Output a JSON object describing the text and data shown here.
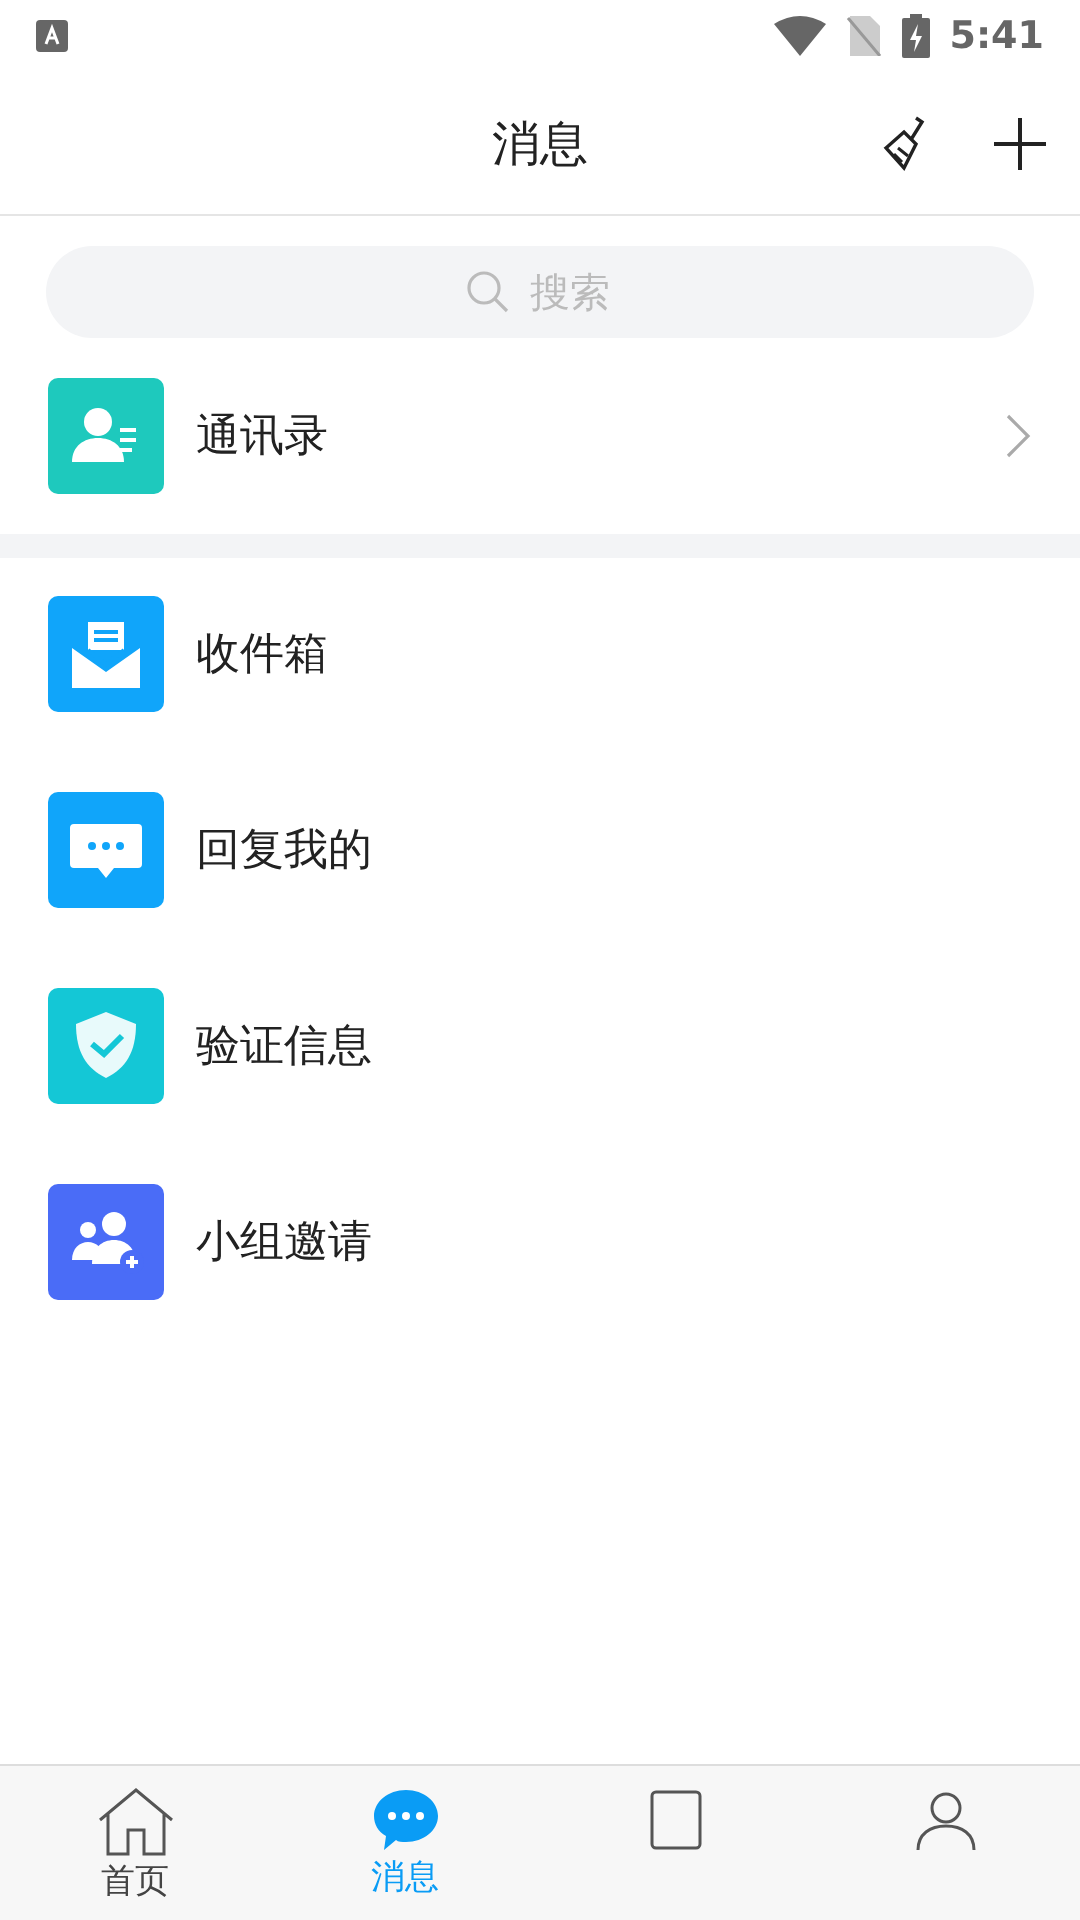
{
  "status_bar": {
    "time": "5:41"
  },
  "header": {
    "title": "消息"
  },
  "search": {
    "placeholder": "搜索"
  },
  "contacts": {
    "label": "通讯录",
    "kind": "contacts",
    "color": "#1ec9bd"
  },
  "items": [
    {
      "label": "收件箱",
      "kind": "inbox",
      "color": "#10a5fa"
    },
    {
      "label": "回复我的",
      "kind": "reply",
      "color": "#10a5fa"
    },
    {
      "label": "验证信息",
      "kind": "verify",
      "color": "#14c7d6"
    },
    {
      "label": "小组邀请",
      "kind": "group",
      "color": "#4a6cf7"
    }
  ],
  "tabs": [
    {
      "label": "首页",
      "kind": "home",
      "selected": false
    },
    {
      "label": "消息",
      "kind": "message",
      "selected": true
    },
    {
      "kind": "notes",
      "selected": false
    },
    {
      "kind": "profile",
      "selected": false
    }
  ]
}
